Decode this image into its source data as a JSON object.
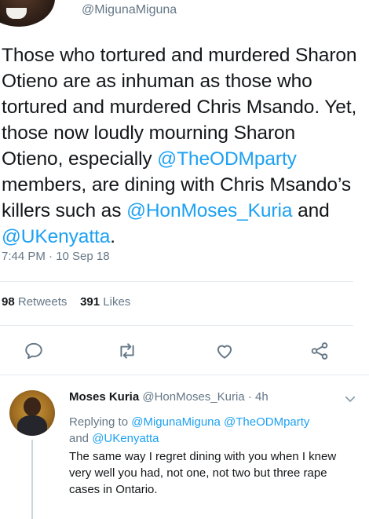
{
  "tweet": {
    "handle": "@MigunaMiguna",
    "text_1": "Those who tortured and murdered Sharon Otieno are as inhuman as those who tortured and murdered Chris Msando. Yet, those now loudly mourning Sharon Otieno, especially ",
    "mention_1": "@TheODMparty",
    "text_2": " members, are dining with Chris Msando’s killers such as ",
    "mention_2": "@HonMoses_Kuria",
    "text_3": " and ",
    "mention_3": "@UKenyatta",
    "text_4": ".",
    "timestamp": "7:44 PM · 10 Sep 18",
    "retweets_count": "98",
    "retweets_label": "Retweets",
    "likes_count": "391",
    "likes_label": "Likes"
  },
  "actions": {
    "reply_icon": "reply-icon",
    "retweet_icon": "retweet-icon",
    "like_icon": "heart-icon",
    "share_icon": "share-icon"
  },
  "reply": {
    "name": "Moses Kuria",
    "handle": "@HonMoses_Kuria",
    "separator": "·",
    "time": "4h",
    "replying_prefix": "Replying to ",
    "replying_mention_1": "@MigunaMiguna",
    "replying_mention_2": "@TheODMparty",
    "replying_and": "and ",
    "replying_mention_3": "@UKenyatta",
    "text": "The same way I regret dining with you when I knew very well you had, not one, not two but three rape cases in Ontario."
  },
  "colors": {
    "link": "#1da1f2",
    "secondary": "#657786",
    "primary": "#14171a",
    "divider": "#e6ecf0"
  }
}
